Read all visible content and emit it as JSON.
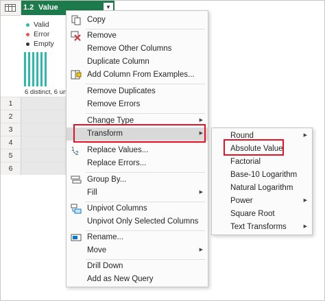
{
  "column": {
    "type_label": "1.2",
    "name": "Value"
  },
  "quality": [
    {
      "label": "Valid",
      "color": "#2bbbad"
    },
    {
      "label": "Error",
      "color": "#e8544e"
    },
    {
      "label": "Empty",
      "color": "#323130"
    }
  ],
  "distribution_text": "6 distinct, 6 un",
  "rows": [
    "1",
    "2",
    "3",
    "4",
    "5",
    "6"
  ],
  "menu": {
    "copy": "Copy",
    "remove": "Remove",
    "remove_other_columns": "Remove Other Columns",
    "duplicate_column": "Duplicate Column",
    "add_column_from_examples": "Add Column From Examples...",
    "remove_duplicates": "Remove Duplicates",
    "remove_errors": "Remove Errors",
    "change_type": "Change Type",
    "transform": "Transform",
    "replace_values": "Replace Values...",
    "replace_errors": "Replace Errors...",
    "group_by": "Group By...",
    "fill": "Fill",
    "unpivot_columns": "Unpivot Columns",
    "unpivot_only_selected": "Unpivot Only Selected Columns",
    "rename": "Rename...",
    "move": "Move",
    "drill_down": "Drill Down",
    "add_as_new_query": "Add as New Query"
  },
  "submenu": {
    "round": "Round",
    "absolute_value": "Absolute Value",
    "factorial": "Factorial",
    "base10_log": "Base-10 Logarithm",
    "natural_log": "Natural Logarithm",
    "power": "Power",
    "square_root": "Square Root",
    "text_transforms": "Text Transforms"
  },
  "highlight_color": "#e81123"
}
